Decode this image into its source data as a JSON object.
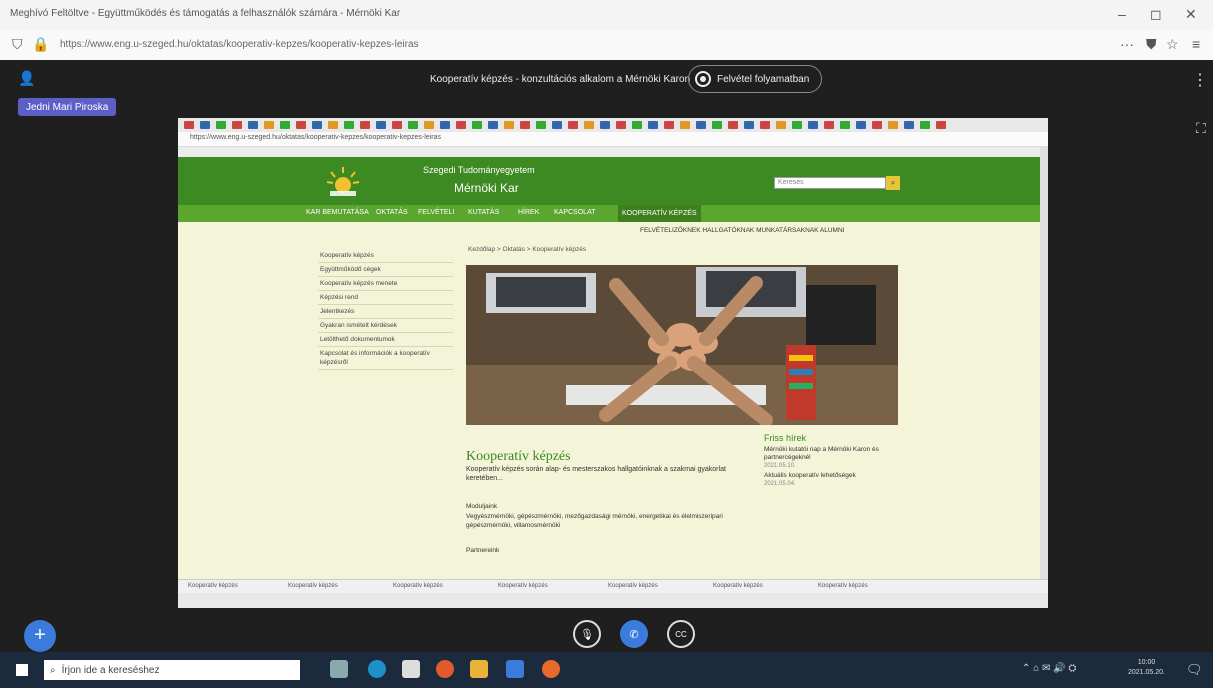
{
  "window": {
    "title": "Meghívó Feltöltve - Együttműködés és támogatás a felhasználók számára - Mérnöki Kar"
  },
  "addressbar": {
    "url": "https://www.eng.u-szeged.hu/oktatas/kooperativ-kepzes/kooperativ-kepzes-leiras"
  },
  "meeting": {
    "title": "Kooperatív képzés - konzultációs alkalom a Mérnöki Karon",
    "recording_label": "Felvétel folyamatban",
    "presenter_label": "Jedni Mari Piroska"
  },
  "site": {
    "university": "Szegedi Tudományegyetem",
    "faculty": "Mérnöki Kar",
    "search_placeholder": "Keresés",
    "nav": [
      "KAR BEMUTATÁSA",
      "OKTATÁS",
      "FELVÉTELI",
      "KUTATÁS",
      "HÍREK",
      "KAPCSOLAT",
      "KOOPERATÍV KÉPZÉS"
    ],
    "subnav": "FELVÉTELIZŐKNEK   HALLGATÓKNAK   MUNKATÁRSAKNAK   ALUMNI",
    "sidebar": [
      "Kooperatív képzés",
      "Együttműködő cégek",
      "Kooperatív képzés menete",
      "Képzési rend",
      "Jelentkezés",
      "Gyakran ismételt kérdések",
      "Letölthető dokumentumok",
      "Kapcsolat és információk a kooperatív képzésről"
    ],
    "breadcrumb": "Kezdőlap > Oktatás > Kooperatív képzés",
    "heading": "Kooperatív képzés",
    "intro": "Kooperatív képzés során alap- és mesterszakos hallgatóinknak a szakmai gyakorlat keretében...",
    "modules_label": "Moduljaink",
    "modules_text": "Vegyészmérnöki, gépészmérnöki, mezőgazdasági mérnöki, energetikai és élelmiszeripari gépészmérnöki, villamosmérnöki",
    "network_label": "Partnereink",
    "news": {
      "heading": "Friss hírek",
      "items": [
        {
          "text": "Mérnöki kutatói nap a Mérnöki Karon és partnercégeknél",
          "date": "2021.05.10."
        },
        {
          "text": "Aktuális kooperatív lehetőségek",
          "date": "2021.05.04."
        }
      ]
    }
  },
  "inner_tabs": [
    "Kooperatív képzés",
    "Kooperatív képzés",
    "Kooperatív képzés",
    "Kooperatív képzés",
    "Kooperatív képzés",
    "Kooperatív képzés",
    "Kooperatív képzés"
  ],
  "taskbar": {
    "search_placeholder": "Írjon ide a kereséshez",
    "time": "10:00",
    "date": "2021.05.20."
  },
  "colors": {
    "site_green": "#3e8a22",
    "nav_green": "#5aa62e",
    "site_bg": "#f4f4d8",
    "teams_purple": "#5b5fc7",
    "call_blue": "#3a7bdc"
  }
}
